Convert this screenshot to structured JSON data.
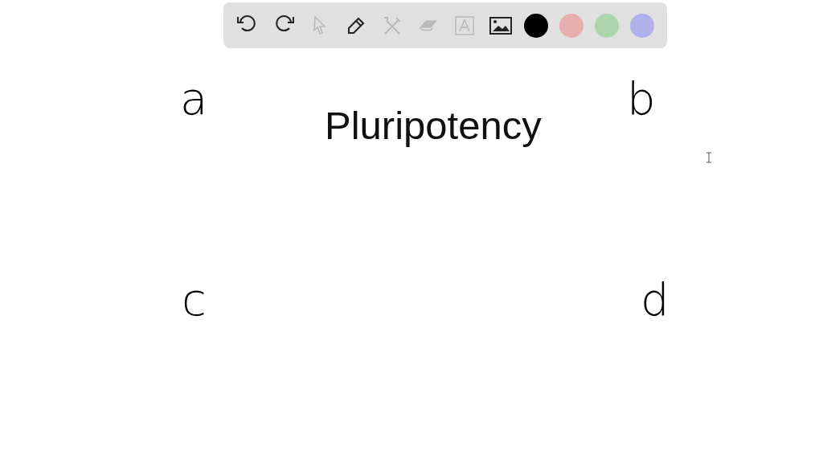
{
  "toolbar": {
    "tools": [
      {
        "kind": "undo",
        "disabled": false
      },
      {
        "kind": "redo",
        "disabled": false
      },
      {
        "kind": "pointer",
        "disabled": true
      },
      {
        "kind": "pen",
        "disabled": false
      },
      {
        "kind": "tools",
        "disabled": true
      },
      {
        "kind": "eraser",
        "disabled": true
      },
      {
        "kind": "text",
        "disabled": true
      },
      {
        "kind": "image",
        "disabled": false
      }
    ],
    "colors": [
      {
        "color": "#000000"
      },
      {
        "color": "#e8aeae"
      },
      {
        "color": "#aed4ae"
      },
      {
        "color": "#b0b0ea"
      }
    ]
  },
  "canvas": {
    "title": "Pluripotency",
    "labels": [
      {
        "text": "a",
        "kind": "handwritten"
      },
      {
        "text": "b",
        "kind": "handwritten"
      },
      {
        "text": "c",
        "kind": "handwritten"
      },
      {
        "text": "d",
        "kind": "handwritten"
      }
    ]
  }
}
